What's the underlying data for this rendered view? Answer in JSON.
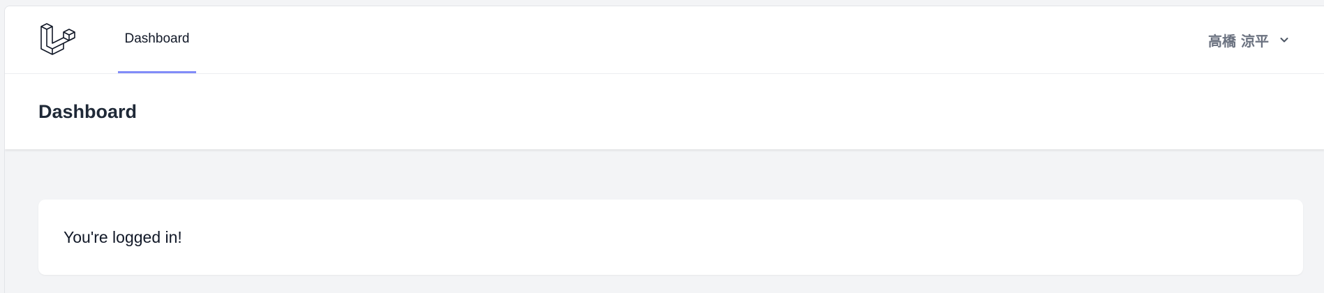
{
  "nav": {
    "links": [
      {
        "label": "Dashboard",
        "active": true
      }
    ],
    "user_name": "高橋 涼平",
    "logo_icon": "laravel-logo-icon",
    "dropdown_icon": "chevron-down-icon"
  },
  "header": {
    "title": "Dashboard"
  },
  "content": {
    "message": "You're logged in!"
  },
  "colors": {
    "active_tab_underline": "#818cf8",
    "page_background": "#f3f4f6",
    "text_primary": "#111827",
    "text_muted": "#6b7280"
  }
}
